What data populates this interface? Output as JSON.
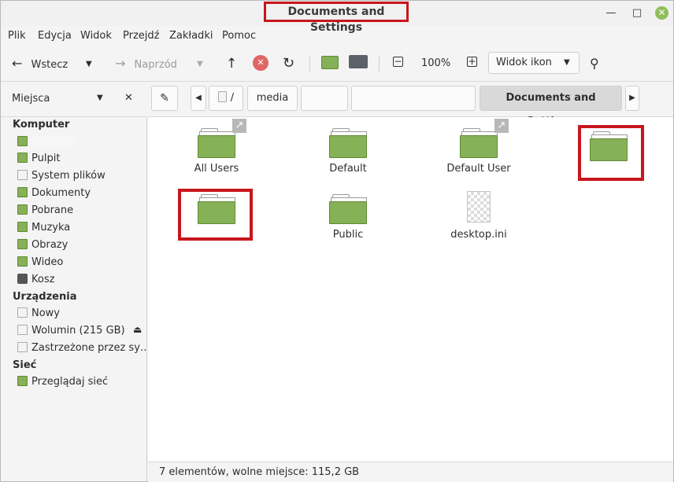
{
  "window": {
    "title": "Documents and Settings",
    "minimize_glyph": "—",
    "maximize_glyph": "□",
    "close_glyph": "✕"
  },
  "menubar": [
    "Plik",
    "Edycja",
    "Widok",
    "Przejdź",
    "Zakładki",
    "Pomoc"
  ],
  "toolbar": {
    "back_label": "Wstecz",
    "forward_label": "Naprzód",
    "zoom_level": "100%",
    "view_mode": "Widok ikon"
  },
  "places": {
    "header": "Miejsca"
  },
  "pathbar": {
    "root": "/",
    "segments": [
      "media",
      "",
      "",
      "Documents and Settings"
    ]
  },
  "sidebar": {
    "sections": [
      {
        "title": "Komputer",
        "items": [
          {
            "label": "",
            "icon": "home-folder-icon"
          },
          {
            "label": "Pulpit",
            "icon": "desktop-icon"
          },
          {
            "label": "System plików",
            "icon": "drive-icon"
          },
          {
            "label": "Dokumenty",
            "icon": "documents-folder-icon"
          },
          {
            "label": "Pobrane",
            "icon": "downloads-folder-icon"
          },
          {
            "label": "Muzyka",
            "icon": "music-folder-icon"
          },
          {
            "label": "Obrazy",
            "icon": "pictures-folder-icon"
          },
          {
            "label": "Wideo",
            "icon": "videos-folder-icon"
          },
          {
            "label": "Kosz",
            "icon": "trash-icon"
          }
        ]
      },
      {
        "title": "Urządzenia",
        "items": [
          {
            "label": "Nowy",
            "icon": "drive-icon"
          },
          {
            "label": "Wolumin (215 GB)",
            "icon": "drive-icon"
          },
          {
            "label": "Zastrzeżone przez sy…",
            "icon": "drive-icon"
          }
        ]
      },
      {
        "title": "Sieć",
        "items": [
          {
            "label": "Przeglądaj sieć",
            "icon": "network-icon"
          }
        ]
      }
    ]
  },
  "files": [
    {
      "name": "All Users",
      "type": "folder-link"
    },
    {
      "name": "Default",
      "type": "folder"
    },
    {
      "name": "Default User",
      "type": "folder-link"
    },
    {
      "name": "",
      "type": "folder"
    },
    {
      "name": "",
      "type": "folder"
    },
    {
      "name": "Public",
      "type": "folder"
    },
    {
      "name": "desktop.ini",
      "type": "file"
    }
  ],
  "status": "7 elementów, wolne miejsce: 115,2 GB",
  "colors": {
    "folder_green": "#87b157",
    "highlight_red": "#c8161d",
    "close_button_green": "#8fbf5a"
  }
}
